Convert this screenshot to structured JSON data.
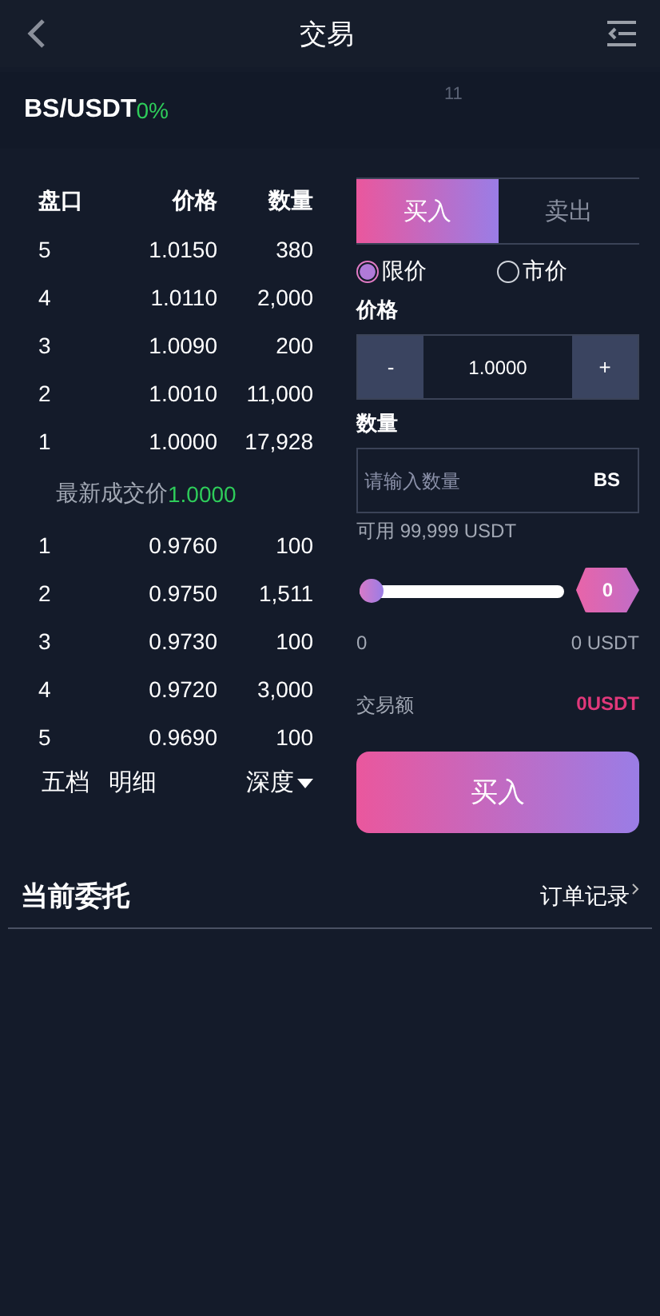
{
  "header": {
    "title": "交易"
  },
  "pair": {
    "symbol": "BS/USDT",
    "change": "0%",
    "faint_text": "11"
  },
  "orderbook": {
    "columns": [
      "盘口",
      "价格",
      "数量"
    ],
    "asks": [
      {
        "level": "5",
        "price": "1.0150",
        "amount": "380"
      },
      {
        "level": "4",
        "price": "1.0110",
        "amount": "2,000"
      },
      {
        "level": "3",
        "price": "1.0090",
        "amount": "200"
      },
      {
        "level": "2",
        "price": "1.0010",
        "amount": "11,000"
      },
      {
        "level": "1",
        "price": "1.0000",
        "amount": "17,928"
      }
    ],
    "latest_label": "最新成交价",
    "latest_price": "1.0000",
    "bids": [
      {
        "level": "1",
        "price": "0.9760",
        "amount": "100"
      },
      {
        "level": "2",
        "price": "0.9750",
        "amount": "1,511"
      },
      {
        "level": "3",
        "price": "0.9730",
        "amount": "100"
      },
      {
        "level": "4",
        "price": "0.9720",
        "amount": "3,000"
      },
      {
        "level": "5",
        "price": "0.9690",
        "amount": "100"
      }
    ],
    "footer_tabs": [
      "五档",
      "明细"
    ],
    "depth": "深度"
  },
  "trade": {
    "tabs": [
      {
        "label": "买入",
        "selected": true
      },
      {
        "label": "卖出",
        "selected": false
      }
    ],
    "order_types": [
      {
        "label": "限价",
        "selected": true
      },
      {
        "label": "市价",
        "selected": false
      }
    ],
    "price_label": "价格",
    "minus": "-",
    "price_value": "1.0000",
    "plus": "+",
    "amount_label": "数量",
    "amount_placeholder": "请输入数量",
    "amount_unit": "BS",
    "available": "可用 99,999 USDT",
    "slider": {
      "level": 0,
      "bubble": "0",
      "min_label": "0",
      "max_label": "0 USDT"
    },
    "total_label": "交易额",
    "total_value": "0USDT",
    "submit": "买入"
  },
  "orders": {
    "title": "当前委托",
    "link": "订单记录"
  }
}
